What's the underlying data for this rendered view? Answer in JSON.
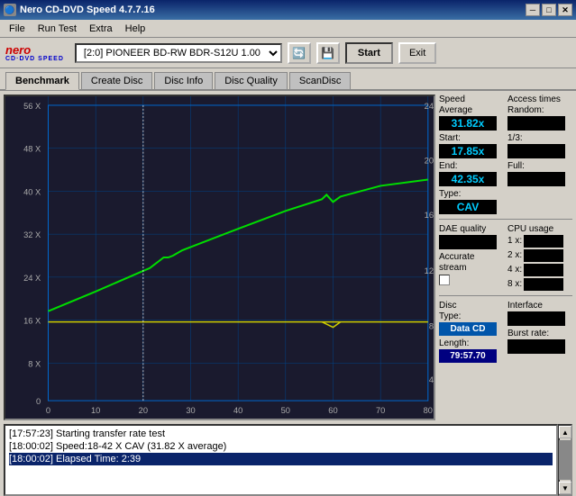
{
  "titleBar": {
    "title": "Nero CD-DVD Speed 4.7.7.16",
    "minBtn": "─",
    "maxBtn": "□",
    "closeBtn": "✕"
  },
  "menuBar": {
    "items": [
      "File",
      "Run Test",
      "Extra",
      "Help"
    ]
  },
  "toolbar": {
    "logoTop": "nero",
    "logoBottom": "CD·DVD SPEED",
    "driveLabel": "[2:0]  PIONEER BD-RW  BDR-S12U 1.00",
    "startLabel": "Start",
    "exitLabel": "Exit"
  },
  "tabs": {
    "items": [
      "Benchmark",
      "Create Disc",
      "Disc Info",
      "Disc Quality",
      "ScanDisc"
    ],
    "active": 0
  },
  "speed": {
    "sectionLabel": "Speed",
    "avgLabel": "Average",
    "avgValue": "31.82x",
    "startLabel": "Start:",
    "startValue": "17.85x",
    "endLabel": "End:",
    "endValue": "42.35x",
    "typeLabel": "Type:",
    "typeValue": "CAV"
  },
  "accessTimes": {
    "sectionLabel": "Access times",
    "randomLabel": "Random:",
    "randomValue": "",
    "oneThirdLabel": "1/3:",
    "oneThirdValue": "",
    "fullLabel": "Full:",
    "fullValue": ""
  },
  "daeQuality": {
    "label": "DAE quality",
    "value": "",
    "accurateStreamLabel": "Accurate",
    "streamLabel": "stream"
  },
  "cpuUsage": {
    "label": "CPU usage",
    "oneX": "1 x:",
    "twoX": "2 x:",
    "fourX": "4 x:",
    "eightX": "8 x:",
    "oneXValue": "",
    "twoXValue": "",
    "fourXValue": "",
    "eightXValue": ""
  },
  "discInfo": {
    "typeLabel": "Disc",
    "typeLabel2": "Type:",
    "typeValue": "Data CD",
    "lengthLabel": "Length:",
    "lengthValue": "79:57.70",
    "interfaceLabel": "Interface",
    "burstLabel": "Burst rate:"
  },
  "statusLog": {
    "lines": [
      {
        "text": "[17:57:23]  Starting transfer rate test",
        "highlight": false
      },
      {
        "text": "[18:00:02]  Speed:18-42 X CAV (31.82 X average)",
        "highlight": false
      },
      {
        "text": "[18:00:02]  Elapsed Time: 2:39",
        "highlight": true
      }
    ]
  },
  "chart": {
    "yAxisLeft": [
      "56 X",
      "48 X",
      "40 X",
      "32 X",
      "24 X",
      "16 X",
      "8 X",
      "0"
    ],
    "yAxisRight": [
      "24",
      "20",
      "16",
      "12",
      "8",
      "4"
    ],
    "xAxis": [
      "0",
      "10",
      "20",
      "30",
      "40",
      "50",
      "60",
      "70",
      "80"
    ]
  }
}
